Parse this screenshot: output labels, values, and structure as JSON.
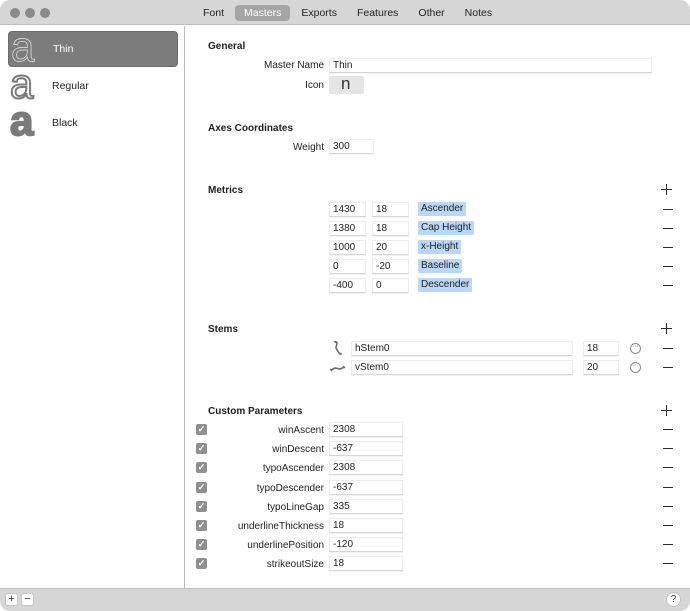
{
  "toolbar": {
    "tabs": [
      {
        "label": "Font",
        "active": false
      },
      {
        "label": "Masters",
        "active": true
      },
      {
        "label": "Exports",
        "active": false
      },
      {
        "label": "Features",
        "active": false
      },
      {
        "label": "Other",
        "active": false
      },
      {
        "label": "Notes",
        "active": false
      }
    ]
  },
  "sidebar": {
    "masters": [
      {
        "name": "Thin",
        "glyph": "a",
        "selected": true
      },
      {
        "name": "Regular",
        "glyph": "a",
        "selected": false
      },
      {
        "name": "Black",
        "glyph": "a",
        "selected": false
      }
    ]
  },
  "general": {
    "title": "General",
    "master_name_label": "Master Name",
    "master_name_value": "Thin",
    "icon_label": "Icon",
    "icon_glyph": "n"
  },
  "axes": {
    "title": "Axes Coordinates",
    "weight_label": "Weight",
    "weight_value": "300"
  },
  "metrics": {
    "title": "Metrics",
    "rows": [
      {
        "position": "1430",
        "overshoot": "18",
        "name": "Ascender"
      },
      {
        "position": "1380",
        "overshoot": "18",
        "name": "Cap Height"
      },
      {
        "position": "1000",
        "overshoot": "20",
        "name": "x-Height"
      },
      {
        "position": "0",
        "overshoot": "-20",
        "name": "Baseline"
      },
      {
        "position": "-400",
        "overshoot": "0",
        "name": "Descender"
      }
    ]
  },
  "stems": {
    "title": "Stems",
    "rows": [
      {
        "name": "hStem0",
        "value": "18",
        "icon": "horizontal-stem-icon"
      },
      {
        "name": "vStem0",
        "value": "20",
        "icon": "vertical-stem-icon"
      }
    ]
  },
  "custom_parameters": {
    "title": "Custom Parameters",
    "rows": [
      {
        "name": "winAscent",
        "value": "2308",
        "checked": true
      },
      {
        "name": "winDescent",
        "value": "-637",
        "checked": true
      },
      {
        "name": "typoAscender",
        "value": "2308",
        "checked": true
      },
      {
        "name": "typoDescender",
        "value": "-637",
        "checked": true
      },
      {
        "name": "typoLineGap",
        "value": "335",
        "checked": true
      },
      {
        "name": "underlineThickness",
        "value": "18",
        "checked": true
      },
      {
        "name": "underlinePosition",
        "value": "-120",
        "checked": true
      },
      {
        "name": "strikeoutSize",
        "value": "18",
        "checked": true
      }
    ]
  },
  "bottombar": {
    "add_label": "+",
    "remove_label": "−",
    "help_label": "?"
  },
  "glyphs": {
    "check": "✓",
    "more": "···"
  },
  "colors": {
    "tag_background": "#b9d7fa",
    "selected_master": "#7c7c7c"
  }
}
